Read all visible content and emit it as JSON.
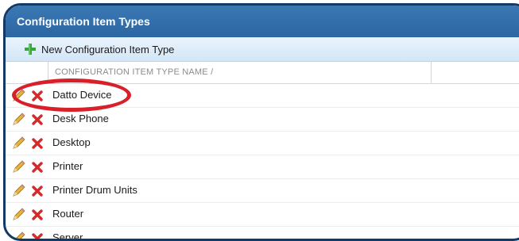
{
  "panel": {
    "title": "Configuration Item Types"
  },
  "toolbar": {
    "new_label": "New Configuration Item Type",
    "new_icon": "plus-icon"
  },
  "table": {
    "column_header": "CONFIGURATION ITEM TYPE NAME  /",
    "rows": [
      {
        "name": "Datto Device"
      },
      {
        "name": "Desk Phone"
      },
      {
        "name": "Desktop"
      },
      {
        "name": "Printer"
      },
      {
        "name": "Printer Drum Units"
      },
      {
        "name": "Router"
      },
      {
        "name": "Server"
      }
    ]
  },
  "colors": {
    "title_bar": "#2c66a3",
    "frame_border": "#123a66",
    "highlight": "#d8202a",
    "delete_icon": "#d42a2a",
    "plus_icon": "#3aa43a"
  }
}
